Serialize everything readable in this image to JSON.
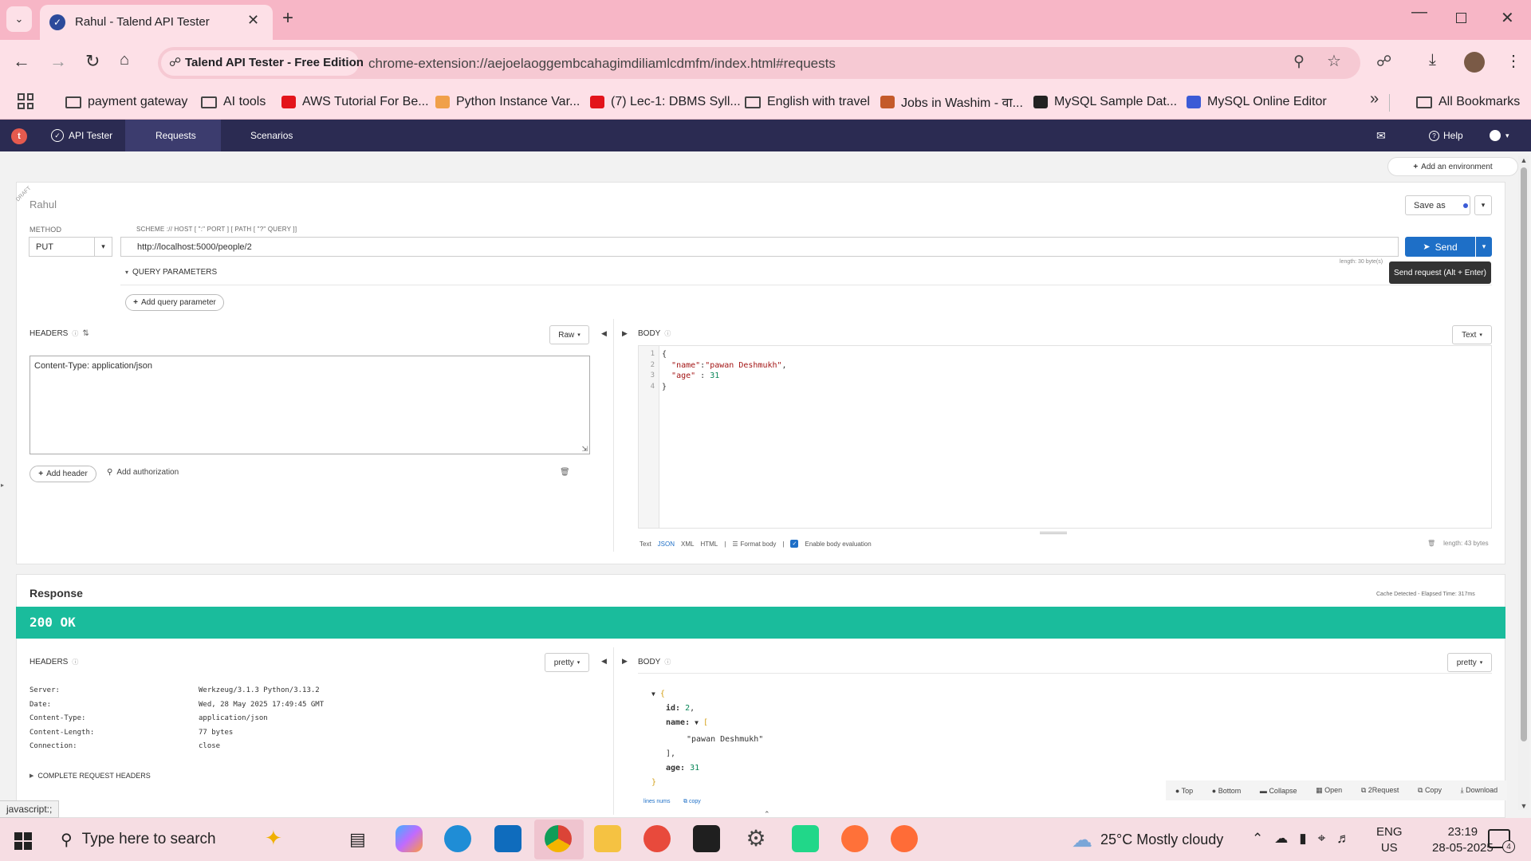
{
  "browser": {
    "tab_title": "Rahul - Talend API Tester",
    "chip_label": "Talend API Tester - Free Edition",
    "url": "chrome-extension://aejoelaoggembcahagimdiliamlcdmfm/index.html#requests",
    "bookmarks": [
      {
        "label": "payment gateway",
        "icon": "folder-icon"
      },
      {
        "label": "AI tools",
        "icon": "folder-icon"
      },
      {
        "label": "AWS Tutorial For Be...",
        "icon": "youtube-icon"
      },
      {
        "label": "Python Instance Var...",
        "icon": "site-icon"
      },
      {
        "label": "(7) Lec-1: DBMS Syll...",
        "icon": "youtube-icon"
      },
      {
        "label": "English with travel",
        "icon": "folder-icon"
      },
      {
        "label": "Jobs in Washim - वा...",
        "icon": "site-icon"
      },
      {
        "label": "MySQL Sample Dat...",
        "icon": "site-icon"
      },
      {
        "label": "MySQL Online Editor",
        "icon": "site-icon"
      }
    ],
    "all_bookmarks": "All Bookmarks"
  },
  "app": {
    "nav": {
      "api_tester": "API Tester",
      "requests": "Requests",
      "scenarios": "Scenarios",
      "help": "Help"
    },
    "add_environment": "Add an environment",
    "draft": "DRAFT",
    "request_name": "Rahul",
    "save_as": "Save as",
    "method_label": "METHOD",
    "method": "PUT",
    "url_label": "SCHEME :// HOST [ \":\" PORT ] [ PATH [ \"?\" QUERY ]]",
    "url": "http://localhost:5000/people/2",
    "send": "Send",
    "length_hint": "length: 30 byte(s)",
    "tooltip": "Send request (Alt + Enter)",
    "query_params": "QUERY PARAMETERS",
    "add_query_param": "Add query parameter",
    "headers_label": "HEADERS",
    "raw": "Raw",
    "headers_text": "Content-Type: application/json",
    "add_header": "Add header",
    "add_authorization": "Add authorization",
    "body_label": "BODY",
    "body_type": "Text",
    "body_lines": [
      "1",
      "2",
      "3",
      "4"
    ],
    "body_formats": {
      "text": "Text",
      "json": "JSON",
      "xml": "XML",
      "html": "HTML"
    },
    "format_body": "Format body",
    "enable_eval": "Enable body evaluation",
    "body_length": "length: 43 bytes"
  },
  "response": {
    "title": "Response",
    "cache_note": "Cache Detected - Elapsed Time: 317ms",
    "status": "200 OK",
    "status_color": "#1abc9c",
    "headers_label": "HEADERS",
    "pretty": "pretty",
    "headers": [
      {
        "name": "Server:",
        "value": "Werkzeug/3.1.3 Python/3.13.2"
      },
      {
        "name": "Date:",
        "value": "Wed, 28 May 2025 17:49:45 GMT"
      },
      {
        "name": "Content-Type:",
        "value": "application/json"
      },
      {
        "name": "Content-Length:",
        "value": "77 bytes"
      },
      {
        "name": "Connection:",
        "value": "close"
      }
    ],
    "complete_headers": "COMPLETE REQUEST HEADERS",
    "body_label": "BODY",
    "body": {
      "id": "2",
      "name_value": "\"pawan Deshmukh\"",
      "age": "31"
    },
    "actions": [
      "Top",
      "Bottom",
      "Collapse",
      "Open",
      "2Request",
      "Copy",
      "Download"
    ],
    "lines_nums": "lines nums",
    "copy": "copy"
  },
  "status_bar": "javascript:;",
  "taskbar": {
    "search_placeholder": "Type here to search",
    "weather": "25°C  Mostly cloudy",
    "lang_top": "ENG",
    "lang_bottom": "US",
    "time": "23:19",
    "date": "28-05-2025",
    "notif_count": "4"
  }
}
